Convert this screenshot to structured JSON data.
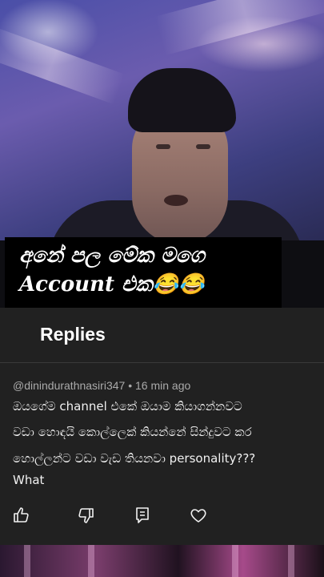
{
  "overlay": {
    "line1": "අනේ පල මේක මගෙ",
    "line2": "Account එක😂😂"
  },
  "replies": {
    "title": "Replies"
  },
  "comment": {
    "author": "@dinindurathnasiri347",
    "separator": "•",
    "time": "16 min ago",
    "lines": [
      "ඔයගේම channel එකේ ඔයාම කියාගන්නවට",
      "වඩා හොඳයි කොල්ලෙක් කියන්නේ සින්දුවට කර",
      "හොල්ලන්ට වඩා වැඩ තියනවා personality???",
      "What"
    ]
  },
  "actions": {
    "like": "thumbs-up-icon",
    "dislike": "thumbs-down-icon",
    "reply": "comment-icon",
    "heart": "heart-icon"
  },
  "colors": {
    "panel_bg": "#212121",
    "meta_text": "#aaaaaa",
    "text": "#f1f1f1"
  }
}
